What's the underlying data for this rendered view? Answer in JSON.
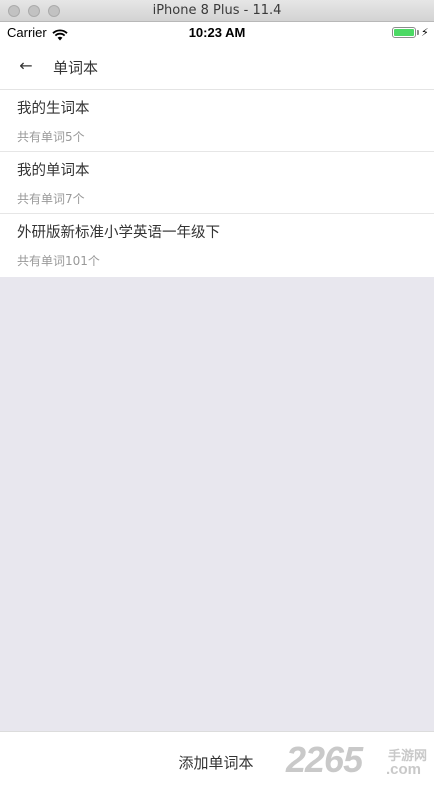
{
  "simulator": {
    "title": "iPhone 8 Plus - 11.4"
  },
  "status_bar": {
    "carrier": "Carrier",
    "time": "10:23 AM",
    "wifi_icon": "wifi-icon",
    "battery_icon": "battery-icon",
    "battery_level": 1.0,
    "battery_color": "#4cd964"
  },
  "nav": {
    "back_icon": "arrow-left-icon",
    "back_glyph": "←",
    "title": "单词本"
  },
  "wordbooks": [
    {
      "title": "我的生词本",
      "count_text": "共有单词5个"
    },
    {
      "title": "我的单词本",
      "count_text": "共有单词7个"
    },
    {
      "title": "外研版新标准小学英语一年级下",
      "count_text": "共有单词101个"
    }
  ],
  "footer": {
    "add_label": "添加单词本"
  },
  "watermark": {
    "number": "2265",
    "cn": "手游网",
    "domain": ".com"
  },
  "colors": {
    "background": "#e8e7ee",
    "surface": "#ffffff",
    "text_primary": "#333333",
    "text_secondary": "#999999"
  }
}
